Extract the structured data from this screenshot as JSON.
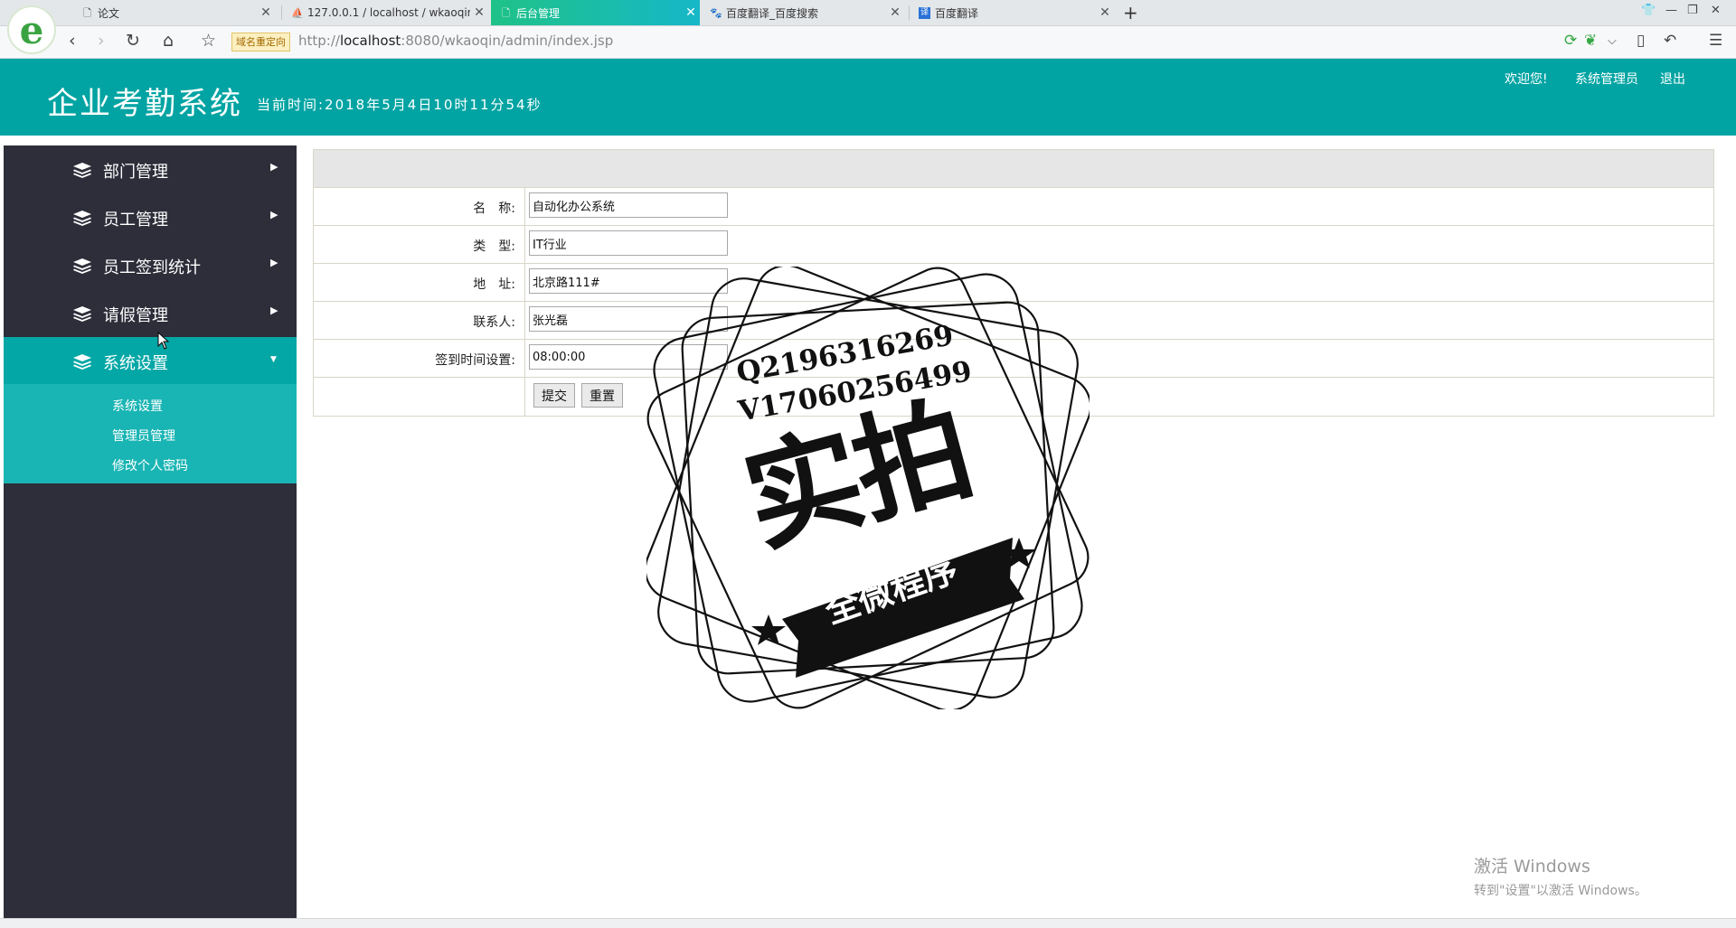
{
  "browser": {
    "tabs": [
      {
        "label": "论文",
        "icon": "document-icon"
      },
      {
        "label": "127.0.0.1 / localhost / wkaoqin",
        "icon": "phpmyadmin-icon"
      },
      {
        "label": "后台管理",
        "icon": "document-icon",
        "active": true
      },
      {
        "label": "百度翻译_百度搜索",
        "icon": "baidu-paw-icon"
      },
      {
        "label": "百度翻译",
        "icon": "translate-icon"
      }
    ],
    "redirect_badge": "域名重定向",
    "url_host": "localhost",
    "url_prefix": "http://",
    "url_rest": ":8080/wkaoqin/admin/index.jsp"
  },
  "header": {
    "title": "企业考勤系统",
    "current_time": "当前时间:2018年5月4日10时11分54秒",
    "welcome": "欢迎您!",
    "user": "系统管理员",
    "logout": "退出"
  },
  "sidebar": {
    "menus": [
      {
        "label": "部门管理",
        "arrow": "▶"
      },
      {
        "label": "员工管理",
        "arrow": "▶"
      },
      {
        "label": "员工签到统计",
        "arrow": "▶"
      },
      {
        "label": "请假管理",
        "arrow": "▶"
      },
      {
        "label": "系统设置",
        "arrow": "▼",
        "open": true
      }
    ],
    "submenu": [
      {
        "label": "系统设置"
      },
      {
        "label": "管理员管理"
      },
      {
        "label": "修改个人密码"
      }
    ]
  },
  "form": {
    "fields": [
      {
        "label": "名　称:",
        "value": "自动化办公系统"
      },
      {
        "label": "类　型:",
        "value": "IT行业"
      },
      {
        "label": "地　址:",
        "value": "北京路111#"
      },
      {
        "label": "联系人:",
        "value": "张光磊"
      },
      {
        "label": "签到时间设置:",
        "value": "08:00:00"
      }
    ],
    "submit": "提交",
    "reset": "重置"
  },
  "watermark": {
    "line1": "Q2196316269",
    "line2": "V17060256499",
    "big": "实拍",
    "ribbon": "全微程序"
  },
  "windows_activation": {
    "line1": "激活 Windows",
    "line2": "转到\"设置\"以激活 Windows。"
  }
}
